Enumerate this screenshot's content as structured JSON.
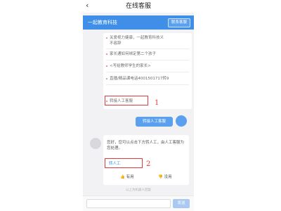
{
  "topbar": {
    "back_glyph": "‹",
    "title": "在线客服"
  },
  "header": {
    "title": "一起教育科技",
    "contact_button": "联系客服"
  },
  "faq": {
    "items": [
      {
        "label": "关爱视力健康，一起教育科技义"
      },
      {
        "label": "不容辞"
      },
      {
        "label": "家长通如何绑定第二个孩子"
      },
      {
        "label": "<写给教师学生的家长>"
      },
      {
        "label": "直播/精品课电话4001501717转9"
      },
      {
        "label": "转接人工客服"
      }
    ]
  },
  "annotations": {
    "one": "1",
    "two": "2"
  },
  "user_message": "转接人工客服",
  "bot_message": {
    "text": "您好，您可以点击下方转人工，由人工客服为您处理。",
    "link": "转人工",
    "useful": "有用",
    "useless": "没用"
  },
  "tip": "以上为机器人回复",
  "input_bar": {
    "send": "发送"
  },
  "colors": {
    "accent": "#3f8fe8",
    "annotation": "#e03a3a"
  }
}
